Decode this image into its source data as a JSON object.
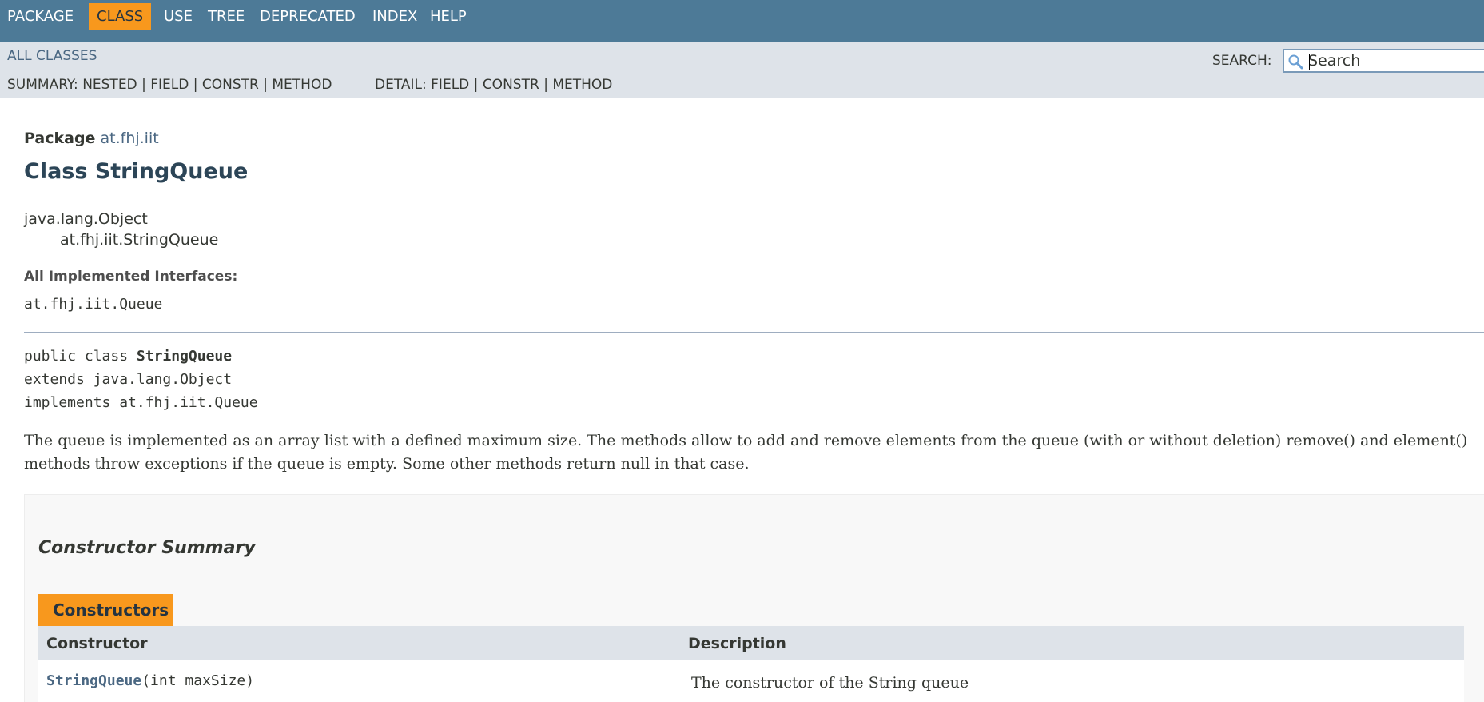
{
  "topnav": {
    "items": [
      "PACKAGE",
      "CLASS",
      "USE",
      "TREE",
      "DEPRECATED",
      "INDEX",
      "HELP"
    ],
    "active": "CLASS",
    "bg_color": "#4D7A97",
    "active_color": "#F8981D"
  },
  "subnav": {
    "all_classes": "ALL CLASSES",
    "summary_label": "SUMMARY:",
    "summary_nested": "NESTED",
    "summary_field": "FIELD",
    "summary_constr": "CONSTR",
    "summary_method": "METHOD",
    "detail_label": "DETAIL:",
    "detail_field": "FIELD",
    "detail_constr": "CONSTR",
    "detail_method": "METHOD",
    "separator": "|",
    "search_label": "SEARCH:",
    "search_placeholder": "Search",
    "search_icon": "search-icon"
  },
  "header": {
    "package_label": "Package",
    "package_name": "at.fhj.iit",
    "class_title": "Class StringQueue"
  },
  "inheritance": [
    "java.lang.Object",
    "at.fhj.iit.StringQueue"
  ],
  "interfaces": {
    "label": "All Implemented Interfaces:",
    "value": "at.fhj.iit.Queue"
  },
  "declaration": {
    "line1_prefix": "public class ",
    "line1_name": "StringQueue",
    "line2": "extends java.lang.Object",
    "line3": "implements at.fhj.iit.Queue"
  },
  "description": "The queue is implemented as an array list with a defined maximum size. The methods allow to add and remove elements from the queue (with or without deletion) remove() and element() methods throw exceptions if the queue is empty. Some other methods return null in that case.",
  "constructor_summary": {
    "heading": "Constructor Summary",
    "tab": "Constructors",
    "col_constructor": "Constructor",
    "col_description": "Description",
    "rows": [
      {
        "name": "StringQueue",
        "params": "(int maxSize)",
        "description": "The constructor of the String queue"
      }
    ]
  }
}
